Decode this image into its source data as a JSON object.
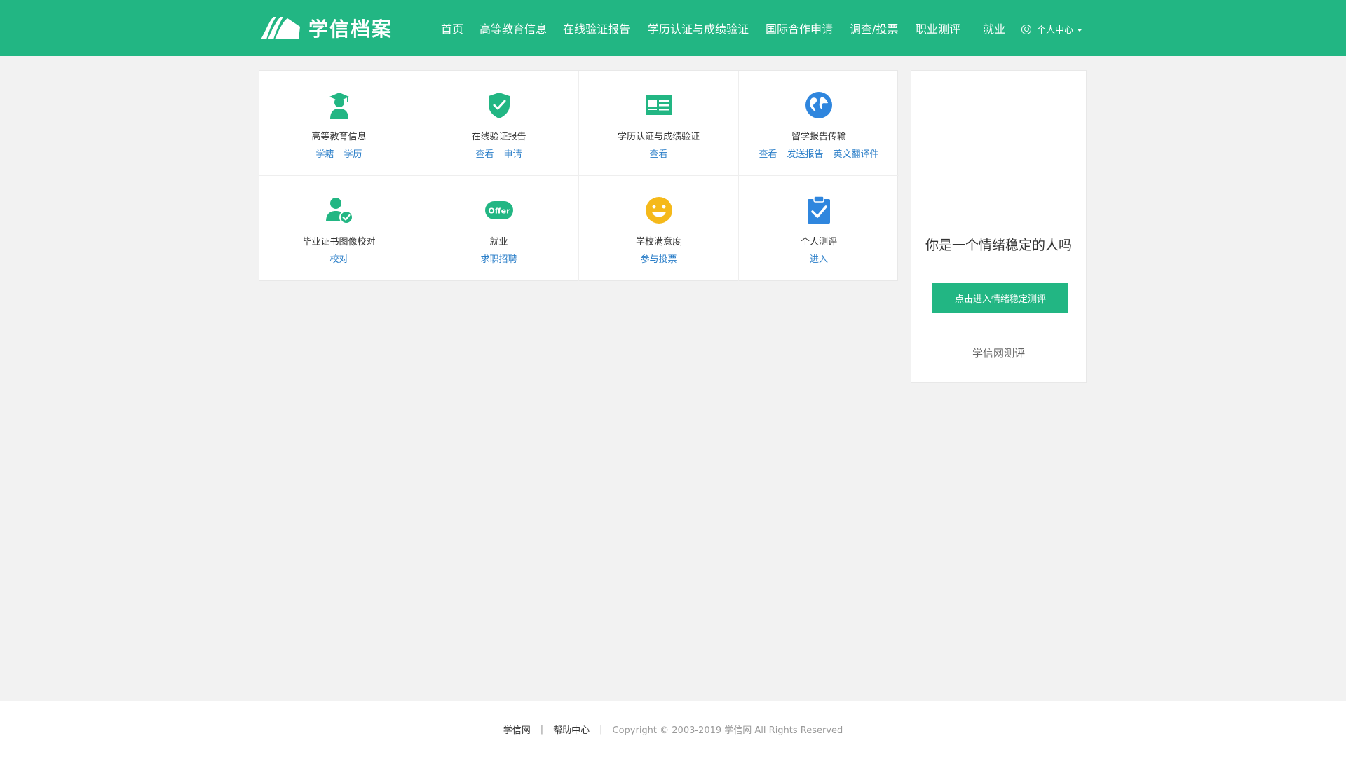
{
  "header": {
    "logo_text": "学信档案",
    "brand_color": "#22b683",
    "nav": [
      {
        "label": "首页"
      },
      {
        "label": "高等教育信息"
      },
      {
        "label": "在线验证报告"
      },
      {
        "label": "学历认证与成绩验证"
      },
      {
        "label": "国际合作申请"
      },
      {
        "label": "调查/投票"
      },
      {
        "label": "职业测评"
      },
      {
        "label": "就业"
      }
    ],
    "user_menu": "个人中心"
  },
  "services": [
    {
      "title": "高等教育信息",
      "icon": "graduate-icon",
      "links": [
        "学籍",
        "学历"
      ]
    },
    {
      "title": "在线验证报告",
      "icon": "shield-check-icon",
      "links": [
        "查看",
        "申请"
      ]
    },
    {
      "title": "学历认证与成绩验证",
      "icon": "id-card-icon",
      "links": [
        "查看"
      ]
    },
    {
      "title": "留学报告传输",
      "icon": "globe-icon",
      "links": [
        "查看",
        "发送报告",
        "英文翻译件"
      ]
    },
    {
      "title": "毕业证书图像校对",
      "icon": "user-check-icon",
      "links": [
        "校对"
      ]
    },
    {
      "title": "就业",
      "icon": "offer-icon",
      "icon_text": "Offer",
      "links": [
        "求职招聘"
      ]
    },
    {
      "title": "学校满意度",
      "icon": "smile-icon",
      "links": [
        "参与投票"
      ]
    },
    {
      "title": "个人测评",
      "icon": "clipboard-check-icon",
      "links": [
        "进入"
      ]
    }
  ],
  "side_panel": {
    "headline": "你是一个情绪稳定的人吗",
    "button": "点击进入情绪稳定测评",
    "brand": "学信网测评"
  },
  "footer": {
    "link1": "学信网",
    "link2": "帮助中心",
    "separator": "|",
    "copyright": "Copyright © 2003-2019 学信网 All Rights Reserved"
  }
}
